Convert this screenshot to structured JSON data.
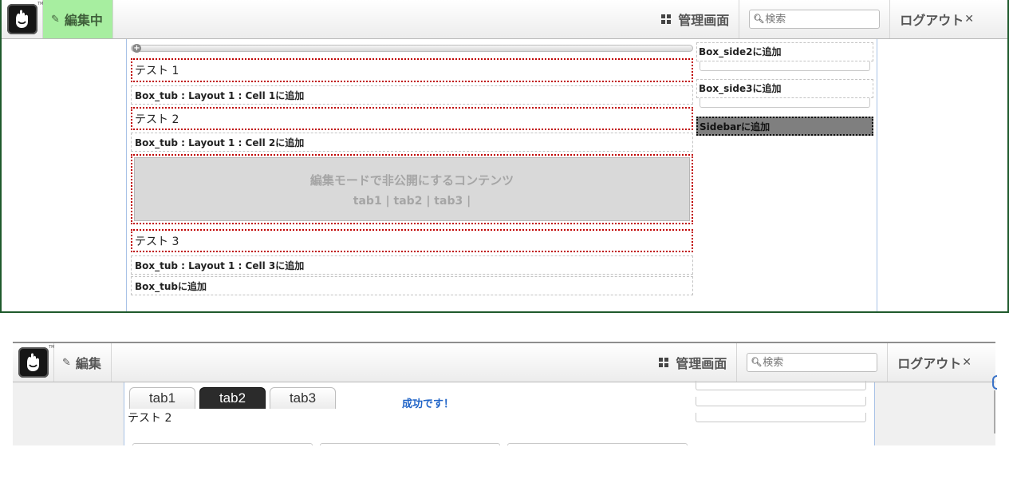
{
  "panel1": {
    "toolbar": {
      "edit_label": "編集中",
      "dashboard_label": "管理画面",
      "search_placeholder": "検索",
      "logout_label": "ログアウト"
    },
    "blocks": {
      "test1": "テスト 1",
      "add_cell1": "Box_tub : Layout 1 : Cell 1に追加",
      "test2": "テスト 2",
      "add_cell2": "Box_tub : Layout 1 : Cell 2に追加",
      "hidden_title": "編集モードで非公開にするコンテンツ",
      "hidden_tabs": "tab1 | tab2 | tab3 |",
      "test3": "テスト 3",
      "add_cell3": "Box_tub : Layout 1 : Cell 3に追加",
      "add_box_tub": "Box_tubに追加"
    },
    "sidebar": {
      "add_side2": "Box_side2に追加",
      "add_side3": "Box_side3に追加",
      "add_sidebar": "Sidebarに追加"
    }
  },
  "panel2": {
    "toolbar": {
      "edit_label": "編集",
      "dashboard_label": "管理画面",
      "search_placeholder": "検索",
      "logout_label": "ログアウト"
    },
    "tabs": [
      "tab1",
      "tab2",
      "tab3"
    ],
    "active_tab": "tab2",
    "success_message": "成功です！",
    "tab_content": "テスト 2"
  },
  "colors": {
    "edit_active_bg": "#a7eea0",
    "edit_area_border": "#c00000",
    "success_text": "#1f63c7",
    "sidebar_area_bg": "#7f7f7f"
  },
  "icons": {
    "logo": "concrete5-hand-logo",
    "edit": "pencil-icon",
    "dashboard": "grid-icon",
    "search": "magnifier-icon",
    "logout": "close-icon"
  }
}
